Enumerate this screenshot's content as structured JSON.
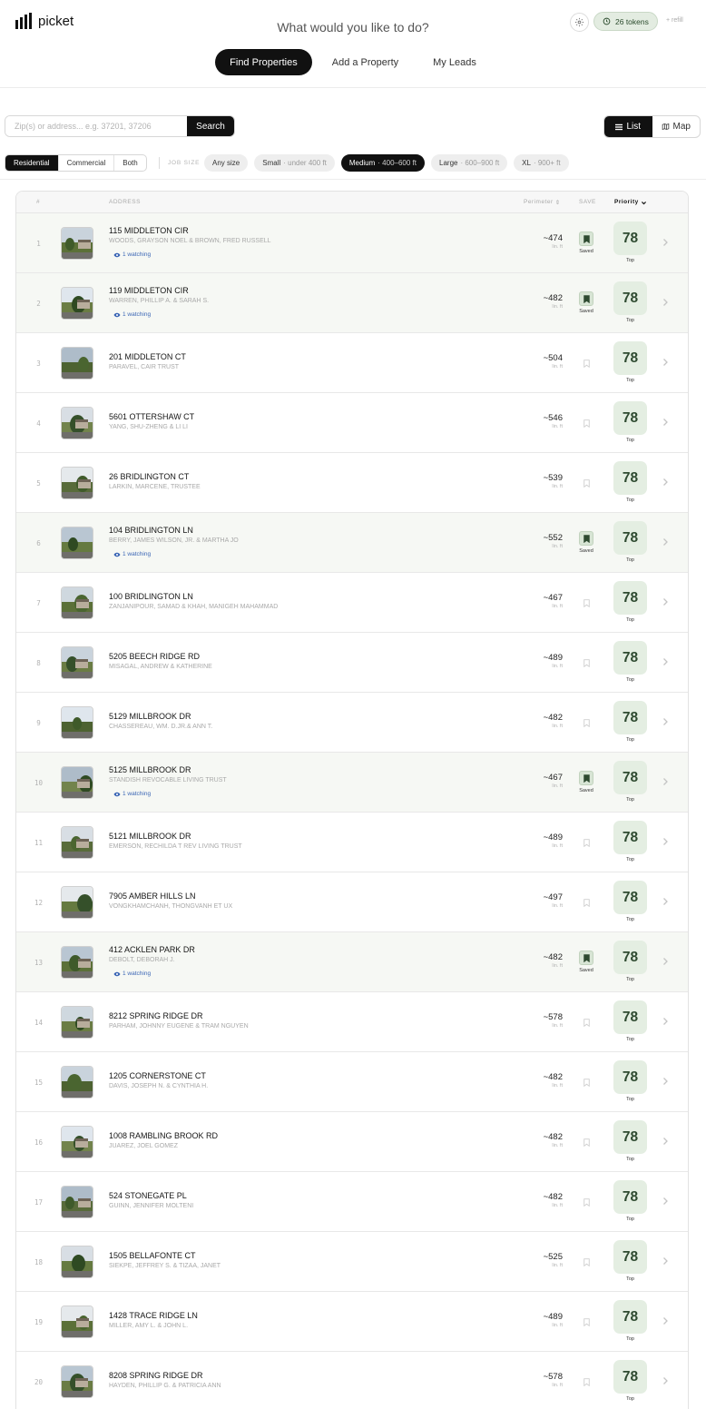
{
  "app": {
    "name": "picket",
    "prompt": "What would you like to do?"
  },
  "header": {
    "tokens_label": "26 tokens",
    "refill_label": "+ refill"
  },
  "nav": [
    "Find Properties",
    "Add a Property",
    "My Leads"
  ],
  "search": {
    "placeholder": "Zip(s) or address... e.g. 37201, 37206",
    "value": "",
    "button_label": "Search"
  },
  "view": {
    "list_label": "List",
    "map_label": "Map",
    "selected": "List"
  },
  "property_types": {
    "options": [
      "Residential",
      "Commercial",
      "Both"
    ],
    "selected": "Residential"
  },
  "job_size": {
    "label": "JOB SIZE",
    "options": [
      {
        "name": "Any size",
        "range": ""
      },
      {
        "name": "Small",
        "range": "· under 400 ft"
      },
      {
        "name": "Medium",
        "range": "· 400–600 ft"
      },
      {
        "name": "Large",
        "range": "· 600–900 ft"
      },
      {
        "name": "XL",
        "range": "· 900+ ft"
      }
    ],
    "selected": "Medium"
  },
  "columns": {
    "num": "#",
    "address": "ADDRESS",
    "perimeter": "Perimeter",
    "save": "SAVE",
    "priority": "Priority"
  },
  "row_text": {
    "unit": "lin. ft",
    "saved": "Saved",
    "tier": "Top"
  },
  "colors": {
    "accent": "#111111",
    "priority_bg": "#e4eee2",
    "priority_text": "#2e4a30",
    "saved_row_bg": "#f6f8f4",
    "watching": "#3b66b5"
  },
  "rows": [
    {
      "num": "1",
      "address": "115 MIDDLETON CIR",
      "owner": "WOODS, GRAYSON NOEL & BROWN, FRED RUSSELL",
      "watching": "1 watching",
      "perimeter": "~474",
      "saved": true,
      "score": "78"
    },
    {
      "num": "2",
      "address": "119 MIDDLETON CIR",
      "owner": "WARREN, PHILLIP A. & SARAH S.",
      "watching": "1 watching",
      "perimeter": "~482",
      "saved": true,
      "score": "78"
    },
    {
      "num": "3",
      "address": "201 MIDDLETON CT",
      "owner": "PARAVEL, CAIR TRUST",
      "watching": "",
      "perimeter": "~504",
      "saved": false,
      "score": "78"
    },
    {
      "num": "4",
      "address": "5601 OTTERSHAW CT",
      "owner": "YANG, SHU-ZHENG & LI LI",
      "watching": "",
      "perimeter": "~546",
      "saved": false,
      "score": "78"
    },
    {
      "num": "5",
      "address": "26 BRIDLINGTON CT",
      "owner": "LARKIN, MARCENE, TRUSTEE",
      "watching": "",
      "perimeter": "~539",
      "saved": false,
      "score": "78"
    },
    {
      "num": "6",
      "address": "104 BRIDLINGTON LN",
      "owner": "BERRY, JAMES WILSON, JR. & MARTHA JO",
      "watching": "1 watching",
      "perimeter": "~552",
      "saved": true,
      "score": "78"
    },
    {
      "num": "7",
      "address": "100 BRIDLINGTON LN",
      "owner": "ZANJANIPOUR, SAMAD & KHAH, MANIGEH MAHAMMAD",
      "watching": "",
      "perimeter": "~467",
      "saved": false,
      "score": "78"
    },
    {
      "num": "8",
      "address": "5205 BEECH RIDGE RD",
      "owner": "MISAGAL, ANDREW & KATHERINE",
      "watching": "",
      "perimeter": "~489",
      "saved": false,
      "score": "78"
    },
    {
      "num": "9",
      "address": "5129 MILLBROOK DR",
      "owner": "CHASSEREAU, WM. D.JR.& ANN T.",
      "watching": "",
      "perimeter": "~482",
      "saved": false,
      "score": "78"
    },
    {
      "num": "10",
      "address": "5125 MILLBROOK DR",
      "owner": "STANDISH REVOCABLE LIVING TRUST",
      "watching": "1 watching",
      "perimeter": "~467",
      "saved": true,
      "score": "78"
    },
    {
      "num": "11",
      "address": "5121 MILLBROOK DR",
      "owner": "EMERSON, RECHILDA T REV LIVING TRUST",
      "watching": "",
      "perimeter": "~489",
      "saved": false,
      "score": "78"
    },
    {
      "num": "12",
      "address": "7905 AMBER HILLS LN",
      "owner": "VONGKHAMCHANH, THONGVANH ET UX",
      "watching": "",
      "perimeter": "~497",
      "saved": false,
      "score": "78"
    },
    {
      "num": "13",
      "address": "412 ACKLEN PARK DR",
      "owner": "DEBOLT, DEBORAH J.",
      "watching": "1 watching",
      "perimeter": "~482",
      "saved": true,
      "score": "78"
    },
    {
      "num": "14",
      "address": "8212 SPRING RIDGE DR",
      "owner": "PARHAM, JOHNNY EUGENE & TRAM NGUYEN",
      "watching": "",
      "perimeter": "~578",
      "saved": false,
      "score": "78"
    },
    {
      "num": "15",
      "address": "1205 CORNERSTONE CT",
      "owner": "DAVIS, JOSEPH N. & CYNTHIA H.",
      "watching": "",
      "perimeter": "~482",
      "saved": false,
      "score": "78"
    },
    {
      "num": "16",
      "address": "1008 RAMBLING BROOK RD",
      "owner": "JUAREZ, JOEL GOMEZ",
      "watching": "",
      "perimeter": "~482",
      "saved": false,
      "score": "78"
    },
    {
      "num": "17",
      "address": "524 STONEGATE PL",
      "owner": "GUINN, JENNIFER MOLTENI",
      "watching": "",
      "perimeter": "~482",
      "saved": false,
      "score": "78"
    },
    {
      "num": "18",
      "address": "1505 BELLAFONTE CT",
      "owner": "SIEKPE, JEFFREY S. & TIZAA, JANET",
      "watching": "",
      "perimeter": "~525",
      "saved": false,
      "score": "78"
    },
    {
      "num": "19",
      "address": "1428 TRACE RIDGE LN",
      "owner": "MILLER, AMY L. & JOHN L.",
      "watching": "",
      "perimeter": "~489",
      "saved": false,
      "score": "78"
    },
    {
      "num": "20",
      "address": "8208 SPRING RIDGE DR",
      "owner": "HAYDEN, PHILLIP G. & PATRICIA ANN",
      "watching": "",
      "perimeter": "~578",
      "saved": false,
      "score": "78"
    }
  ]
}
